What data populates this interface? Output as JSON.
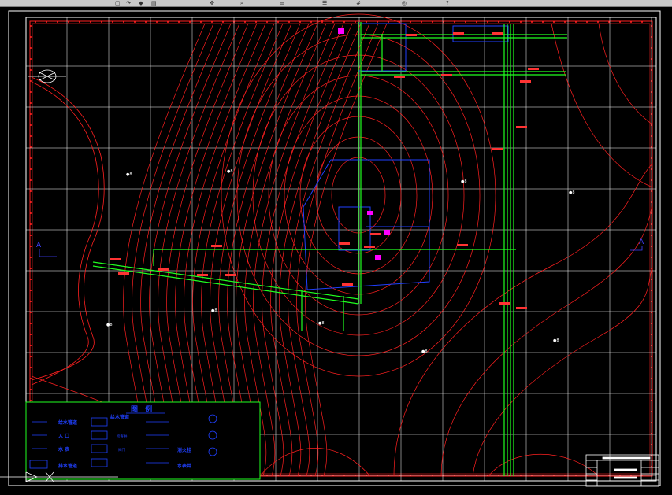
{
  "toolbar": {
    "icons": [
      "open-icon",
      "redo-icon",
      "save-icon",
      "print-icon",
      "pan-icon",
      "zoom-icon",
      "layer-icon",
      "properties-icon",
      "grid-icon",
      "snap-icon",
      "help-icon"
    ]
  },
  "drawing": {
    "section_mark_left": "A",
    "section_mark_right": "A",
    "colors": {
      "background": "#000000",
      "contour": "#ff2020",
      "grid": "#ffffff",
      "pipe": "#20ff20",
      "boundary": "#2040ff",
      "marker": "#ff00ff",
      "tag": "#ff3333"
    },
    "legend": {
      "title": "图  例",
      "entries": [
        "给水管道",
        "入  口",
        "水  表",
        "排水管道",
        "给水管道",
        "检查井",
        "阀门",
        "消火栓",
        "水表井"
      ]
    }
  }
}
